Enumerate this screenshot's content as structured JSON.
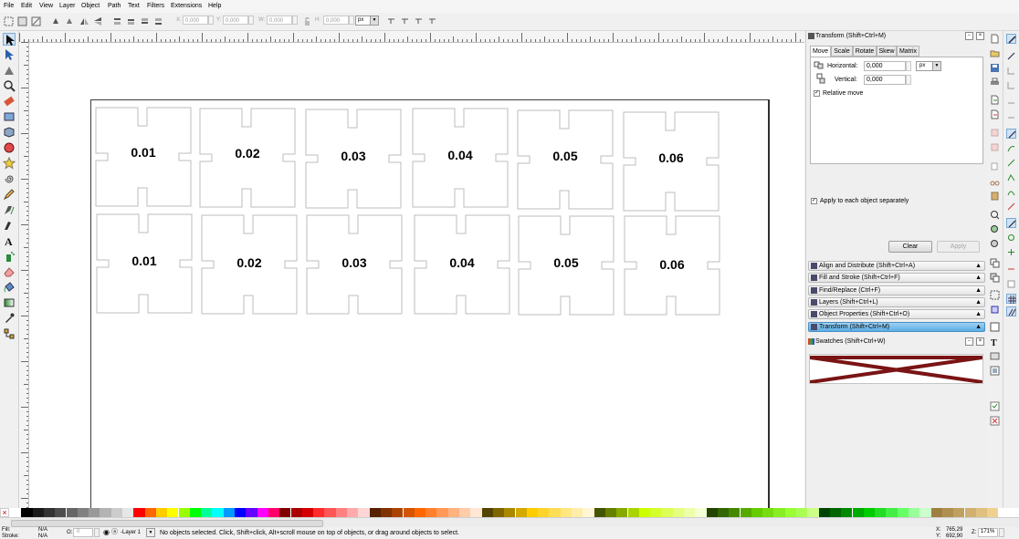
{
  "menubar": {
    "items": [
      "File",
      "Edit",
      "View",
      "Layer",
      "Object",
      "Path",
      "Text",
      "Filters",
      "Extensions",
      "Help"
    ]
  },
  "toolcontrols": {
    "x_label": "X:",
    "x_value": "0,000",
    "y_label": "Y:",
    "y_value": "0,000",
    "w_label": "W:",
    "w_value": "0,000",
    "h_label": "H:",
    "h_value": "0,000",
    "unit": "px"
  },
  "canvas": {
    "row1_labels": [
      "0.01",
      "0.02",
      "0.03",
      "0.04",
      "0.05",
      "0.06"
    ],
    "row2_labels": [
      "0.01",
      "0.02",
      "0.03",
      "0.04",
      "0.05",
      "0.06"
    ]
  },
  "transform_dialog": {
    "title": "Transform (Shift+Ctrl+M)",
    "tabs": [
      "Move",
      "Scale",
      "Rotate",
      "Skew",
      "Matrix"
    ],
    "horizontal_label": "Horizontal:",
    "horizontal_value": "0,000",
    "vertical_label": "Vertical:",
    "vertical_value": "0,000",
    "unit": "px",
    "relative_move_label": "Relative move",
    "relative_move_checked": true,
    "apply_each_label": "Apply to each object separately",
    "apply_each_checked": true,
    "clear_label": "Clear",
    "apply_label": "Apply"
  },
  "dock": {
    "items": [
      "Align and Distribute (Shift+Ctrl+A)",
      "Fill and Stroke (Shift+Ctrl+F)",
      "Find/Replace (Ctrl+F)",
      "Layers (Shift+Ctrl+L)",
      "Object Properties (Shift+Ctrl+O)",
      "Transform (Shift+Ctrl+M)"
    ],
    "active_index": 5,
    "swatches_title": "Swatches (Shift+Ctrl+W)"
  },
  "statusbar": {
    "fill_label": "Fill:",
    "fill_value": "N/A",
    "stroke_label": "Stroke:",
    "stroke_value": "N/A",
    "opacity_label": "O:",
    "opacity_value": "0",
    "layer": "-Layer 1",
    "message": "No objects selected. Click, Shift+click, Alt+scroll mouse on top of objects, or drag around objects to select.",
    "x_label": "X:",
    "x_value": "765,29",
    "y_label": "Y:",
    "y_value": "692,90",
    "zoom_label": "Z:",
    "zoom_value": "171%"
  },
  "palette": {
    "colors": [
      "#ffffff",
      "#000000",
      "#1a1a1a",
      "#333333",
      "#4d4d4d",
      "#666666",
      "#808080",
      "#999999",
      "#b3b3b3",
      "#cccccc",
      "#e6e6e6",
      "#ff0000",
      "#ff6600",
      "#ffcc00",
      "#ffff00",
      "#99ff00",
      "#00ff00",
      "#00ff99",
      "#00ffff",
      "#0099ff",
      "#0000ff",
      "#6600ff",
      "#ff00ff",
      "#ff0066",
      "#800000",
      "#aa0000",
      "#d40000",
      "#ff2a2a",
      "#ff5555",
      "#ff8080",
      "#ffaaaa",
      "#ffd5d5",
      "#552200",
      "#803300",
      "#aa4400",
      "#d45500",
      "#ff6600",
      "#ff7f2a",
      "#ff9955",
      "#ffb380",
      "#ffccaa",
      "#ffe6d5",
      "#554400",
      "#806600",
      "#aa8800",
      "#d4aa00",
      "#ffcc00",
      "#ffd42a",
      "#ffdd55",
      "#ffe680",
      "#ffeeaa",
      "#fff6d5",
      "#445500",
      "#668000",
      "#88aa00",
      "#aad400",
      "#ccff00",
      "#d4ff2a",
      "#ddff55",
      "#e5ff80",
      "#eeffaa",
      "#f6ffd5",
      "#224400",
      "#336600",
      "#448800",
      "#55aa00",
      "#66cc00",
      "#77dd11",
      "#88ee22",
      "#99ff33",
      "#aaff55",
      "#ccff88",
      "#004400",
      "#006600",
      "#008800",
      "#00aa00",
      "#00cc00",
      "#22dd22",
      "#44ee44",
      "#66ff66",
      "#99ff99",
      "#ccffcc",
      "#a08040",
      "#b09050",
      "#c0a060",
      "#d0b070",
      "#e0c080",
      "#f0d090"
    ]
  }
}
